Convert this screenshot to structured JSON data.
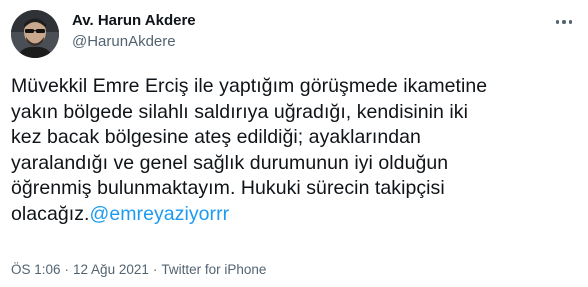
{
  "author": {
    "display_name": "Av. Harun Akdere",
    "handle": "@HarunAkdere",
    "avatar_icon": "profile-photo"
  },
  "more_icon": "more-horizontal-icon",
  "tweet": {
    "text_lines": [
      "Müvekkil Emre Erciş ile yaptığım görüşmede ikametine",
      "yakın bölgede silahlı saldırıya uğradığı, kendisinin iki",
      "kez bacak bölgesine ateş edildiği; ayaklarından",
      "yaralandığı ve genel sağlık durumunun iyi olduğun",
      "öğrenmiş bulunmaktayım. Hukuki sürecin takipçisi",
      "olacağız."
    ],
    "mention": "@emreyaziyorrr"
  },
  "meta": {
    "time": "ÖS 1:06",
    "separator": "·",
    "date": "12 Ağu 2021",
    "source": "Twitter for iPhone"
  },
  "colors": {
    "text": "#0f1419",
    "secondary": "#536471",
    "link": "#1d9bf0",
    "background": "#ffffff"
  }
}
